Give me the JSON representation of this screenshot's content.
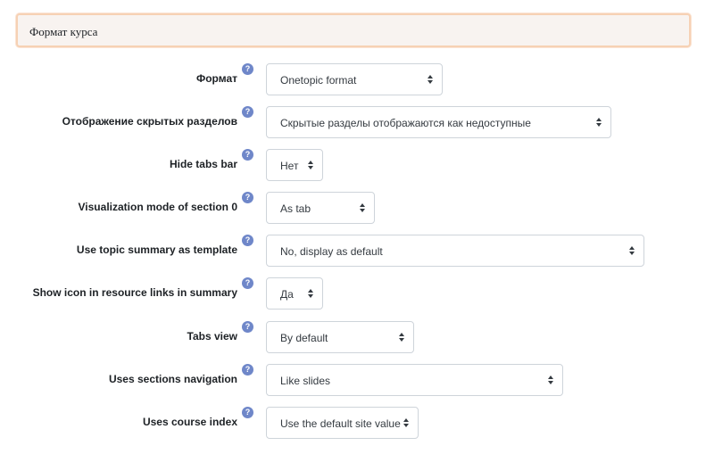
{
  "section": {
    "title": "Формат курса"
  },
  "help_glyph": "?",
  "fields": [
    {
      "label": "Формат",
      "value": "Onetopic format"
    },
    {
      "label": "Отображение скрытых разделов",
      "value": "Скрытые разделы отображаются как недоступные"
    },
    {
      "label": "Hide tabs bar",
      "value": "Нет"
    },
    {
      "label": "Visualization mode of section 0",
      "value": "As tab"
    },
    {
      "label": "Use topic summary as template",
      "value": "No, display as default"
    },
    {
      "label": "Show icon in resource links in summary",
      "value": "Да"
    },
    {
      "label": "Tabs view",
      "value": "By default"
    },
    {
      "label": "Uses sections navigation",
      "value": "Like slides"
    },
    {
      "label": "Uses course index",
      "value": "Use the default site value"
    }
  ],
  "colors": {
    "header_border": "#f6d1b4",
    "header_bg": "#f8f3f0",
    "help_icon": "#6f87c9"
  }
}
